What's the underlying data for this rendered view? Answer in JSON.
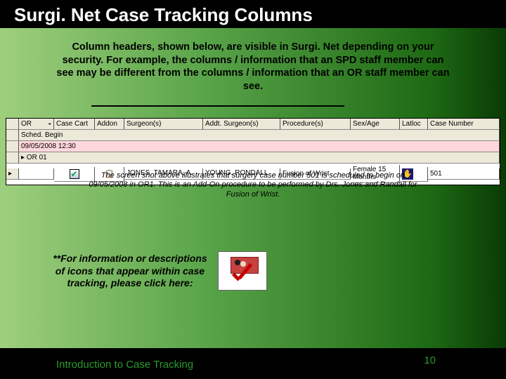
{
  "title": "Surgi. Net Case Tracking Columns",
  "paragraph": "Column headers, shown below, are visible in Surgi. Net depending on your security. For example, the columns / information that an SPD staff member can see may be different from the columns / information that an OR staff member can see.",
  "headers": {
    "sel": "",
    "or": "OR",
    "cart": "Case Cart",
    "addon": "Addon",
    "surgeon": "Surgeon(s)",
    "addt_surgeon": "Addt. Surgeon(s)",
    "procedure": "Procedure(s)",
    "sex_age": "Sex/Age",
    "latloc": "Latloc",
    "case_no": "Case Number"
  },
  "subheader": {
    "sched": "Sched. Begin"
  },
  "row_date": {
    "date": "09/05/2008 12:30"
  },
  "row_group": {
    "label": "▸ OR 01"
  },
  "row_data": {
    "surgeon": "JONES, TAMARA, A.",
    "addt_surgeon": "YOUNG, RONDALL",
    "procedure": "Fusion of Wrist",
    "sex_age": "Female 15 Months",
    "latloc": "",
    "case_no": "501"
  },
  "caption": "The screen shot above illustrates that surgery case number 501  is scheduled to begin on 09/05/2008 in OR1. This is an Add-On procedure to be performed by Drs. Jones and Randall for Fusion of Wrist.",
  "info_text": "**For information or descriptions of icons that appear within case tracking, please click here:",
  "footer_left": "Introduction to Case Tracking",
  "footer_right": "10"
}
